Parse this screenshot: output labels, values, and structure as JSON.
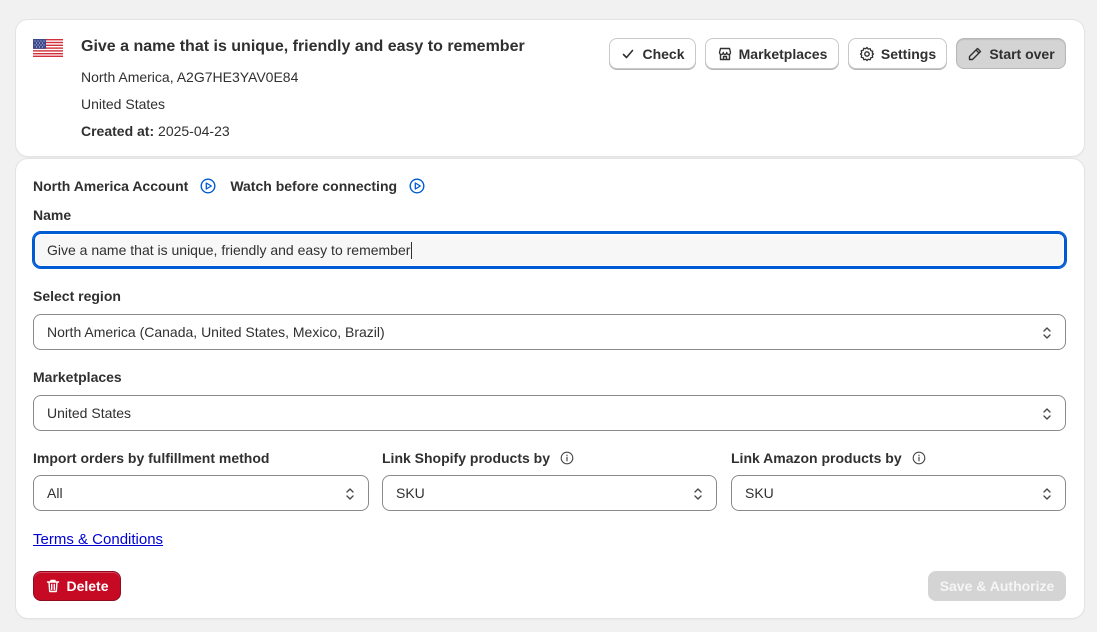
{
  "account": {
    "flag_icon": "us-flag-icon",
    "title": "Give a name that is unique, friendly and easy to remember",
    "region_id": "North America, A2G7HE3YAV0E84",
    "country": "United States",
    "created_label": "Created at:",
    "created_value": "2025-04-23"
  },
  "toolbar": {
    "check_label": "Check",
    "marketplaces_label": "Marketplaces",
    "settings_label": "Settings",
    "start_over_label": "Start over"
  },
  "form": {
    "section_title": "North America Account",
    "watch_label": "Watch before connecting",
    "name_label": "Name",
    "name_value": "Give a name that is unique, friendly and easy to remember",
    "region_label": "Select region",
    "region_value": "North America (Canada, United States, Mexico, Brazil)",
    "marketplaces_label": "Marketplaces",
    "marketplaces_value": "United States",
    "import_label": "Import orders by fulfillment method",
    "import_value": "All",
    "link_shopify_label": "Link Shopify products by",
    "link_shopify_value": "SKU",
    "link_amazon_label": "Link Amazon products by",
    "link_amazon_value": "SKU",
    "terms_link": "Terms & Conditions",
    "delete_label": "Delete",
    "save_label": "Save & Authorize"
  },
  "colors": {
    "primary_focus": "#005bd3",
    "delete_bg": "#c70a24",
    "disabled_bg": "#d4d4d4",
    "link": "#0000d5"
  }
}
